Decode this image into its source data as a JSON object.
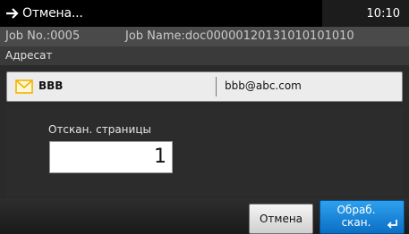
{
  "status": {
    "title": "Отмена...",
    "time": "10:10"
  },
  "job": {
    "number": "Job No.:0005",
    "name": "Job Name:doc00000120131010101010"
  },
  "destination": {
    "section_label": "Адресат",
    "name": "BBB",
    "email": "bbb@abc.com"
  },
  "pages": {
    "label": "Отскан. страницы",
    "value": "1"
  },
  "buttons": {
    "cancel": "Отмена",
    "process_line1": "Обраб.",
    "process_line2": "скан."
  },
  "icons": {
    "status": "arrow-right-icon",
    "destination": "envelope-icon",
    "process": "enter-icon"
  },
  "colors": {
    "accent": "#1e88d8",
    "envelope": "#f0b400"
  }
}
